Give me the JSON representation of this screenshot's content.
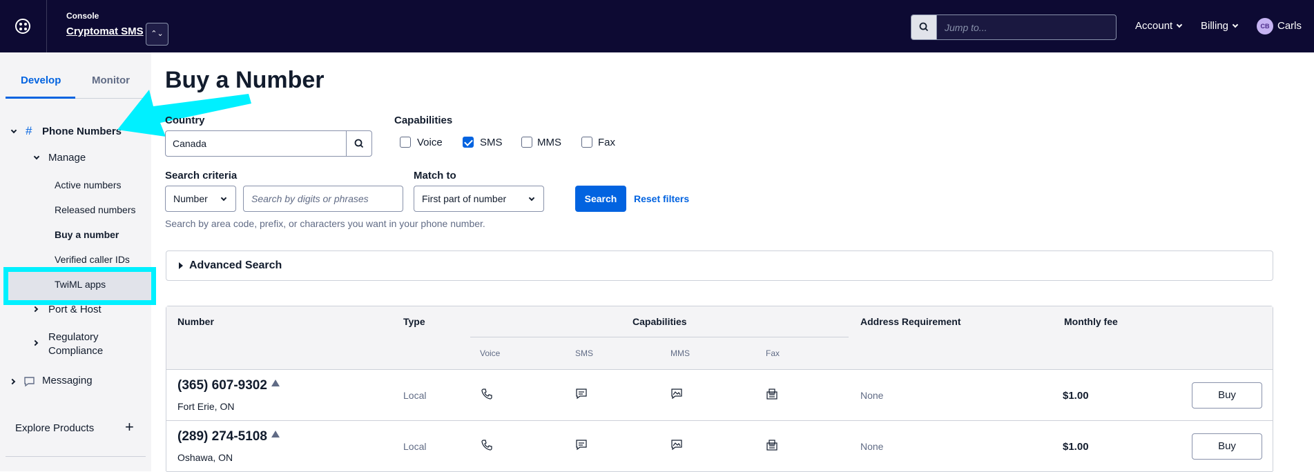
{
  "header": {
    "console_label": "Console",
    "account_name": "Cryptomat SMS",
    "search_placeholder": "Jump to...",
    "nav": [
      "Account",
      "Billing"
    ],
    "user_initials": "CB",
    "user_name": "Carls"
  },
  "sidebar": {
    "tabs": [
      "Develop",
      "Monitor"
    ],
    "phone_numbers": "Phone Numbers",
    "manage": "Manage",
    "manage_items": [
      "Active numbers",
      "Released numbers",
      "Buy a number",
      "Verified caller IDs",
      "TwiML apps"
    ],
    "port_host": "Port & Host",
    "regulatory_1": "Regulatory",
    "regulatory_2": "Compliance",
    "messaging": "Messaging",
    "explore": "Explore Products"
  },
  "main": {
    "title": "Buy a Number",
    "country_label": "Country",
    "country_value": "Canada",
    "capabilities_label": "Capabilities",
    "capabilities": [
      {
        "label": "Voice",
        "checked": false
      },
      {
        "label": "SMS",
        "checked": true
      },
      {
        "label": "MMS",
        "checked": false
      },
      {
        "label": "Fax",
        "checked": false
      }
    ],
    "criteria_label": "Search criteria",
    "criteria_value": "Number",
    "search_placeholder": "Search by digits or phrases",
    "match_label": "Match to",
    "match_value": "First part of number",
    "search_button": "Search",
    "reset_link": "Reset filters",
    "help_text": "Search by area code, prefix, or characters you want in your phone number.",
    "advanced": "Advanced Search"
  },
  "table": {
    "headers": {
      "number": "Number",
      "type": "Type",
      "capabilities": "Capabilities",
      "address": "Address Requirement",
      "fee": "Monthly fee"
    },
    "sub_headers": [
      "Voice",
      "SMS",
      "MMS",
      "Fax"
    ],
    "rows": [
      {
        "number": "(365) 607-9302",
        "location": "Fort Erie, ON",
        "type": "Local",
        "address": "None",
        "fee": "$1.00",
        "action": "Buy"
      },
      {
        "number": "(289) 274-5108",
        "location": "Oshawa, ON",
        "type": "Local",
        "address": "None",
        "fee": "$1.00",
        "action": "Buy"
      }
    ]
  },
  "colors": {
    "topbar": "#0d0a33",
    "primary": "#0263e0",
    "highlight": "#00f0ff"
  }
}
